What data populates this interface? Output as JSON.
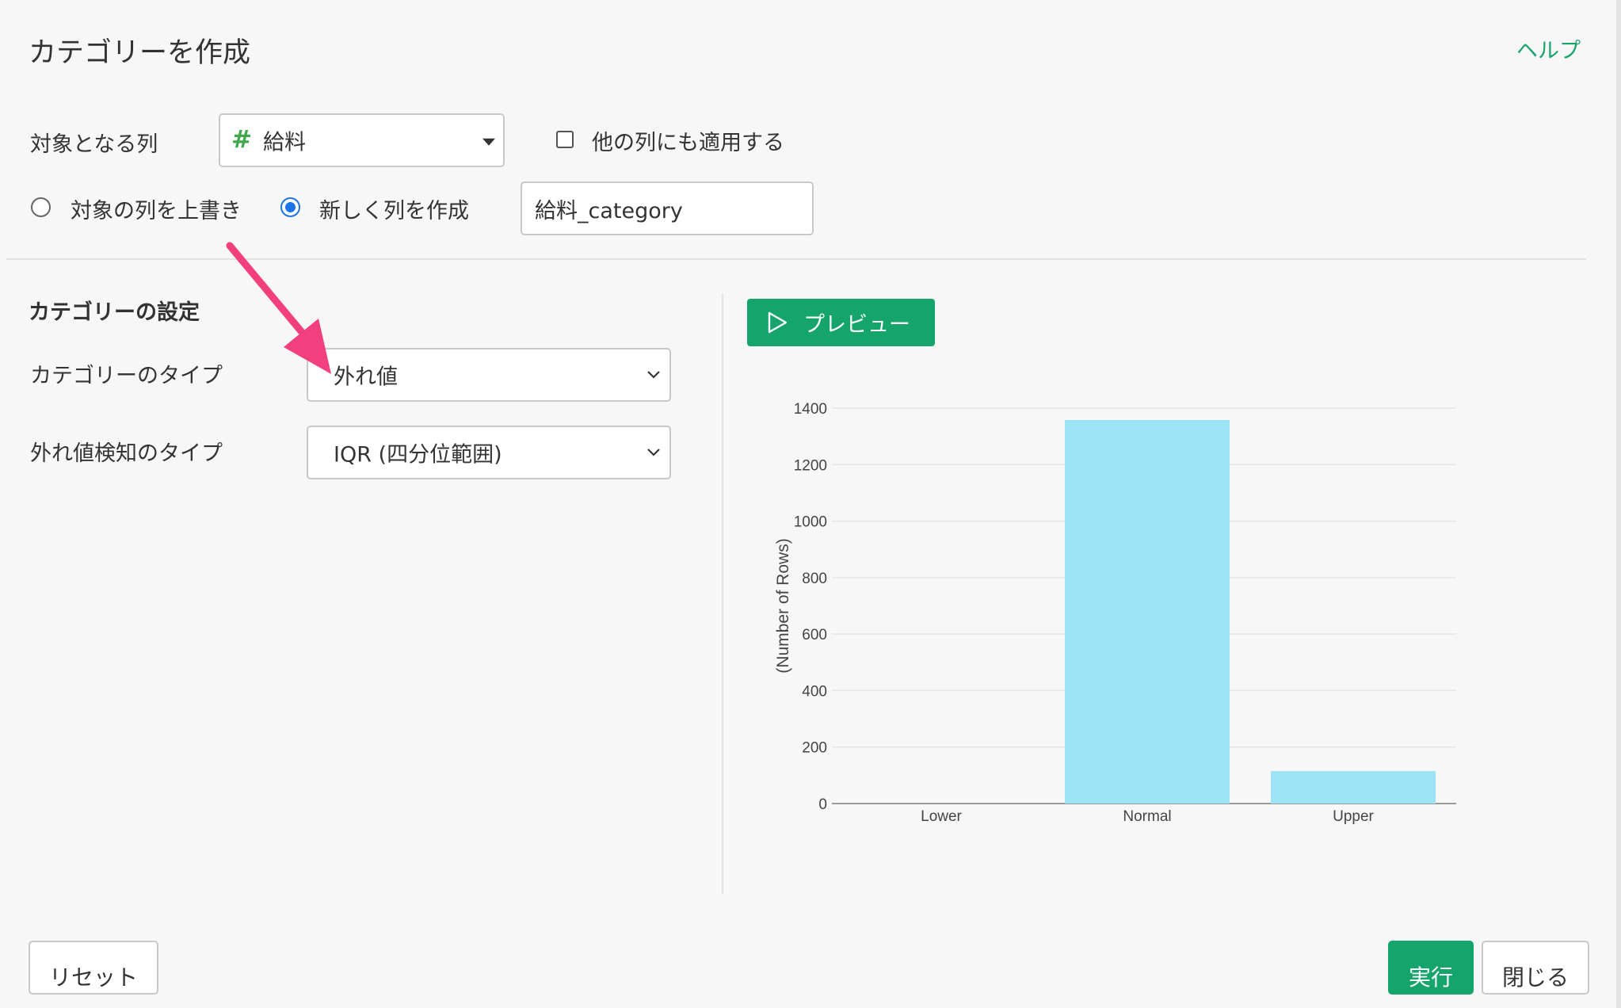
{
  "dialog": {
    "title": "カテゴリーを作成",
    "help_label": "ヘルプ"
  },
  "target": {
    "label": "対象となる列",
    "column_icon": "#",
    "column_value": "給料",
    "apply_other_label": "他の列にも適用する",
    "apply_other_checked": false
  },
  "output": {
    "overwrite_label": "対象の列を上書き",
    "overwrite_checked": false,
    "create_new_label": "新しく列を作成",
    "create_new_checked": true,
    "new_column_name": "給料_category"
  },
  "settings": {
    "section_title": "カテゴリーの設定",
    "category_type_label": "カテゴリーのタイプ",
    "category_type_value": "外れ値",
    "outlier_type_label": "外れ値検知のタイプ",
    "outlier_type_value": "IQR (四分位範囲)"
  },
  "preview": {
    "button_label": "プレビュー"
  },
  "chart_data": {
    "type": "bar",
    "categories": [
      "Lower",
      "Normal",
      "Upper"
    ],
    "values": [
      0,
      1358,
      115
    ],
    "ylabel": "(Number of Rows)",
    "xlabel": "",
    "ylim": [
      0,
      1400
    ],
    "yticks": [
      0,
      200,
      400,
      600,
      800,
      1000,
      1200,
      1400
    ],
    "grid": true,
    "bar_color": "#9ce4f5"
  },
  "footer": {
    "reset_label": "リセット",
    "run_label": "実行",
    "close_label": "閉じる"
  },
  "colors": {
    "accent": "#14a46c",
    "annotation_arrow": "#f23f7e",
    "radio_checked": "#1d73e8"
  }
}
